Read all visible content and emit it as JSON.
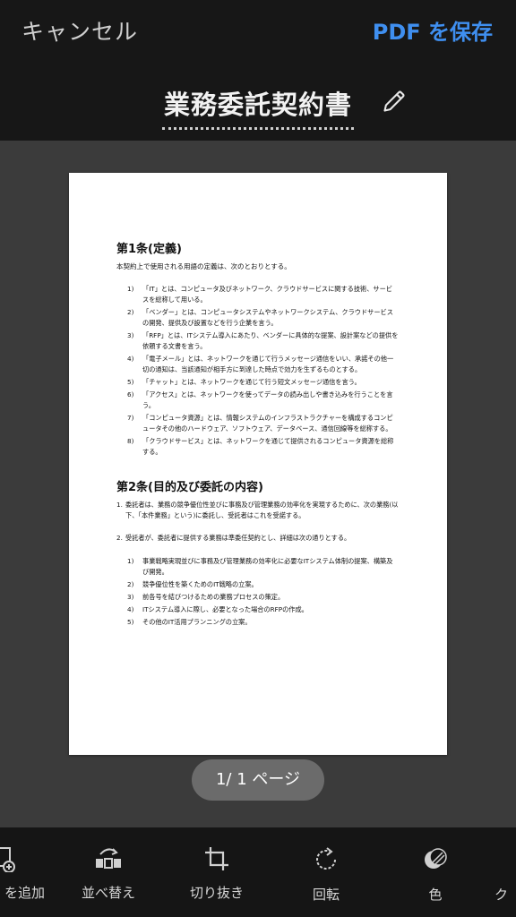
{
  "header": {
    "cancel_label": "キャンセル",
    "save_label": "PDF を保存",
    "title": "業務委託契約書"
  },
  "document": {
    "section1": {
      "title": "第1条(定義)",
      "intro": "本契約上で使用される用語の定義は、次のとおりとする。",
      "items": [
        {
          "num": "1)",
          "text": "「IT」とは、コンピュータ及びネットワーク、クラウドサービスに関する技術、サービスを総称して用いる。"
        },
        {
          "num": "2)",
          "text": "「ベンダー」とは、コンピュータシステムやネットワークシステム、クラウドサービスの開発、提供及び設置などを行う企業を言う。"
        },
        {
          "num": "3)",
          "text": "「RFP」とは、ITシステム導入にあたり、ベンダーに具体的な提案、設計案などの提供を依頼する文書を言う。"
        },
        {
          "num": "4)",
          "text": "「電子メール」とは、ネットワークを通じて行うメッセージ通信をいい、承諾その他一切の通知は、当該通知が相手方に到達した時点で効力を生ずるものとする。"
        },
        {
          "num": "5)",
          "text": "「チャット」とは、ネットワークを通じて行う短文メッセージ通信を言う。"
        },
        {
          "num": "6)",
          "text": "「アクセス」とは、ネットワークを使ってデータの読み出しや書き込みを行うことを言う。"
        },
        {
          "num": "7)",
          "text": "「コンピュータ資源」とは、情報システムのインフラストラクチャーを構成するコンピュータその他のハードウェア、ソフトウェア、データベース、通信回線等を総称する。"
        },
        {
          "num": "8)",
          "text": "「クラウドサービス」とは、ネットワークを通じて提供されるコンピュータ資源を総称する。"
        }
      ]
    },
    "section2": {
      "title": "第2条(目的及び委託の内容)",
      "para1_num": "1.",
      "para1": "委託者は、業務の競争優位性並びに事務及び管理業務の効率化を実現するために、次の業務(以下、「本件業務」という)に委託し、受託者はこれを受諾する。",
      "para2_num": "2.",
      "para2": "受託者が、委託者に提供する業務は準委任契約とし、詳細は次の通りとする。",
      "items": [
        {
          "num": "1)",
          "text": "事業戦略実現並びに事務及び管理業務の効率化に必要なITシステム体制の提案、構築及び開発。"
        },
        {
          "num": "2)",
          "text": "競争優位性を築くためのIT戦略の立案。"
        },
        {
          "num": "3)",
          "text": "前各号を結びつけるための業務プロセスの策定。"
        },
        {
          "num": "4)",
          "text": "ITシステム導入に際し、必要となった場合のRFPの作成。"
        },
        {
          "num": "5)",
          "text": "その他のIT活用プランニングの立案。"
        }
      ]
    }
  },
  "pager": {
    "label": "1/ 1 ページ"
  },
  "toolbar": {
    "add_label": "を追加",
    "reorder_label": "並べ替え",
    "crop_label": "切り抜き",
    "rotate_label": "回転",
    "color_label": "色",
    "cleanup_label": "ク"
  },
  "colors": {
    "accent": "#3f8ff0",
    "topbar": "#171717",
    "background": "#3b3b3b"
  }
}
